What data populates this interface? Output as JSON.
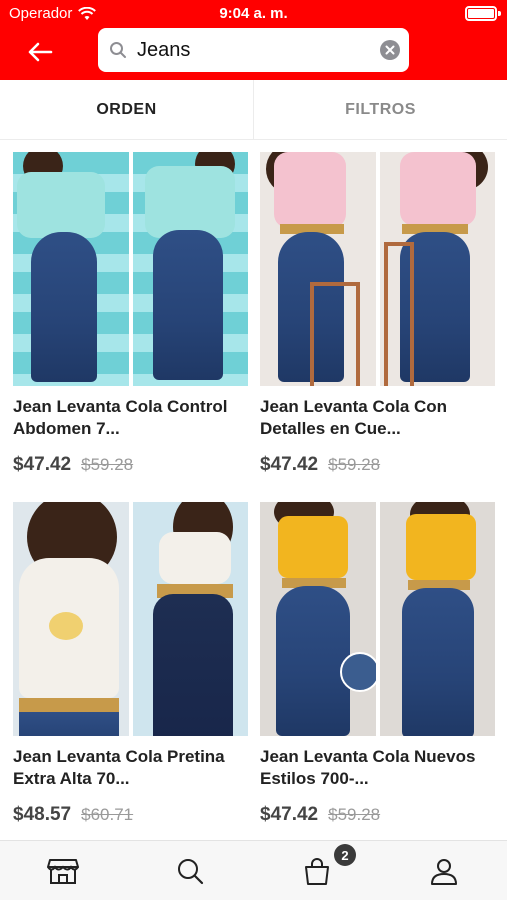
{
  "status_bar": {
    "carrier": "Operador",
    "time": "9:04 a. m."
  },
  "search": {
    "value": "Jeans",
    "placeholder": ""
  },
  "tabs": [
    {
      "label": "ORDEN",
      "active": true
    },
    {
      "label": "FILTROS",
      "active": false
    }
  ],
  "products": [
    {
      "name": "Jean Levanta Cola Control Abdomen 7...",
      "price": "$47.42",
      "old_price": "$59.28"
    },
    {
      "name": "Jean Levanta Cola Con Detalles en Cue...",
      "price": "$47.42",
      "old_price": "$59.28"
    },
    {
      "name": "Jean Levanta Cola Pretina Extra Alta 70...",
      "price": "$48.57",
      "old_price": "$60.71"
    },
    {
      "name": "Jean Levanta Cola Nuevos Estilos 700-...",
      "price": "$47.42",
      "old_price": "$59.28"
    }
  ],
  "bottom_nav": {
    "items": [
      "store-icon",
      "search-icon",
      "bag-icon",
      "user-icon"
    ],
    "cart_badge": "2"
  },
  "colors": {
    "brand": "#ff0000",
    "price": "#444444",
    "old_price": "#9a9a9a"
  }
}
